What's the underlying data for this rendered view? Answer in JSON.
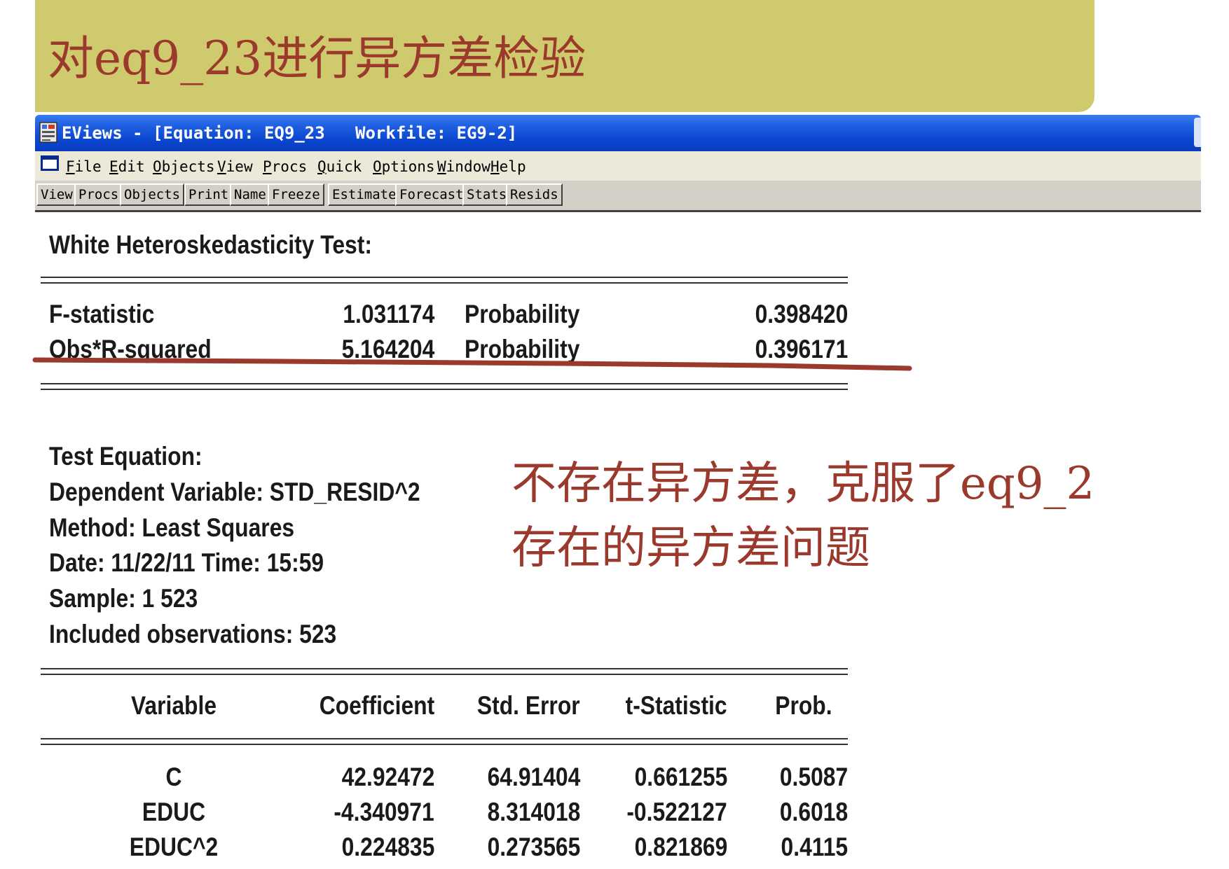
{
  "slide": {
    "title": "对eq9_23进行异方差检验",
    "annotation_line1": "不存在异方差，克服了eq9_2",
    "annotation_line2": "存在的异方差问题",
    "accent_color": "#9b3a2c",
    "banner_color": "#cfca6e"
  },
  "window": {
    "title": "EViews - [Equation: EQ9_23   Workfile: EG9-2]",
    "app_icon": "eviews-app-icon",
    "menu": [
      "File",
      "Edit",
      "Objects",
      "View",
      "Procs",
      "Quick",
      "Options",
      "Window",
      "Help"
    ],
    "toolbar": [
      "View",
      "Procs",
      "Objects",
      "Print",
      "Name",
      "Freeze",
      "Estimate",
      "Forecast",
      "Stats",
      "Resids"
    ]
  },
  "output": {
    "heading": "White Heteroskedasticity Test:",
    "stats": [
      {
        "label": "F-statistic",
        "value": "1.031174",
        "prob_label": "Probability",
        "prob": "0.398420"
      },
      {
        "label": "Obs*R-squared",
        "value": "5.164204",
        "prob_label": "Probability",
        "prob": "0.396171"
      }
    ],
    "test_info": [
      "Test Equation:",
      "Dependent Variable: STD_RESID^2",
      "Method: Least Squares",
      "Date: 11/22/11   Time: 15:59",
      "Sample: 1 523",
      "Included observations: 523"
    ],
    "table": {
      "columns": [
        "Variable",
        "Coefficient",
        "Std. Error",
        "t-Statistic",
        "Prob."
      ],
      "rows": [
        [
          "C",
          "42.92472",
          "64.91404",
          "0.661255",
          "0.5087"
        ],
        [
          "EDUC",
          "-4.340971",
          "8.314018",
          "-0.522127",
          "0.6018"
        ],
        [
          "EDUC^2",
          "0.224835",
          "0.273565",
          "0.821869",
          "0.4115"
        ]
      ]
    }
  }
}
